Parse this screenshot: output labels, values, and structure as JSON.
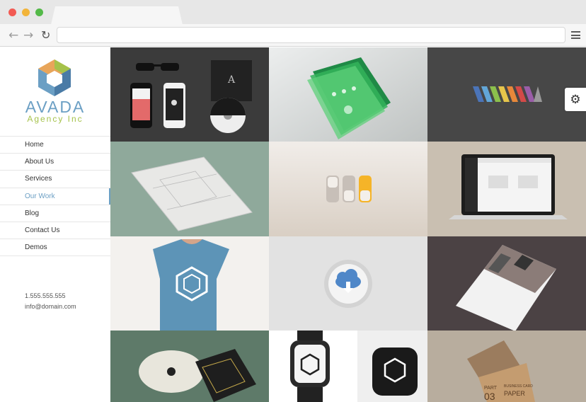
{
  "browser": {
    "back_icon": "arrow-left-icon",
    "forward_icon": "arrow-right-icon",
    "reload_icon": "reload-icon",
    "menu_icon": "hamburger-menu-icon",
    "address": ""
  },
  "brand": {
    "name": "AVADA",
    "tagline": "Agency Inc",
    "colors": {
      "blue": "#6b9fc4",
      "green": "#a5c24a",
      "orange": "#e8a55a"
    }
  },
  "nav": [
    {
      "label": "Home",
      "active": false
    },
    {
      "label": "About Us",
      "active": false
    },
    {
      "label": "Services",
      "active": false
    },
    {
      "label": "Our Work",
      "active": true
    },
    {
      "label": "Blog",
      "active": false
    },
    {
      "label": "Contact Us",
      "active": false
    },
    {
      "label": "Demos",
      "active": false
    }
  ],
  "contact": {
    "phone": "1.555.555.555",
    "email": "info@domain.com"
  },
  "portfolio": [
    {
      "name": "stationery-glasses-phones"
    },
    {
      "name": "green-app-screens"
    },
    {
      "name": "striped-logo"
    },
    {
      "name": "wireframe-paper"
    },
    {
      "name": "toggle-switches"
    },
    {
      "name": "laptop-dashboard"
    },
    {
      "name": "tshirt-logo"
    },
    {
      "name": "cloud-download-icon"
    },
    {
      "name": "magazine-flyer"
    },
    {
      "name": "cd-cover"
    },
    {
      "name": "smartwatch"
    },
    {
      "name": "paper-business-cards"
    }
  ],
  "tile_text": {
    "card_part": "PART",
    "card_number": "03",
    "card_title": "BUSINESS CARD",
    "card_paper": "PAPER"
  },
  "settings_icon": "gear-icon"
}
